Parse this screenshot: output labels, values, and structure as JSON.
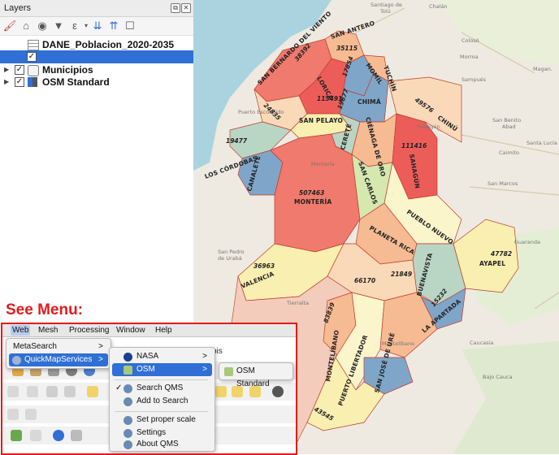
{
  "layers_panel": {
    "title": "Layers",
    "toolbar_icons": [
      "paintbrush-icon",
      "add-group-icon",
      "eye-icon",
      "filter-icon",
      "expression-filter-icon",
      "expand-all-icon",
      "collapse-all-icon",
      "remove-layer-icon"
    ],
    "layers": [
      {
        "name": "DANE_Poblacion_2020-2035",
        "checked": false,
        "icon": "table-icon"
      },
      {
        "name": "",
        "checked": true,
        "selected": true
      },
      {
        "name": "Municipios",
        "checked": true,
        "icon": "polygon-layer-icon",
        "expander": "▶"
      },
      {
        "name": "OSM Standard",
        "checked": true,
        "icon": "tile-layer-icon",
        "expander": "▶"
      }
    ]
  },
  "map": {
    "colors": {
      "dark_red": "#ec5d5a",
      "red": "#ef7a6d",
      "peach": "#f6bb92",
      "light_peach": "#fad9b8",
      "yellow": "#f8efb0",
      "light_yellow": "#fbf5cc",
      "green": "#d5e8b0",
      "blue": "#7fa6c9",
      "pale": "#f4e4c8",
      "teal": "#b9d6c5",
      "border": "#c0392b"
    },
    "base_labels": [
      "Santiago de\nTolú",
      "Chalán",
      "Colosó",
      "Morroa",
      "Sampués",
      "Magan.",
      "San Benito\nAbad",
      "Caimito",
      "San Marcos",
      "Santa Lucía",
      "Guaranda",
      "San Pedro\nde Urabá",
      "Caucasia",
      "Bajo Cauca",
      "Tierralta",
      "Montelíbano",
      "Puerto Escondido",
      "Tuchín",
      "Sahagún",
      "Cereté",
      "Montería",
      "Lorica",
      "Chimá",
      "Momil",
      "Purísima"
    ],
    "municipios": [
      {
        "name": "SAN ANTERO",
        "value": "35115"
      },
      {
        "name": "SAN BERNARDO DEL VIENTO",
        "value": "38392"
      },
      {
        "name": "MOMIL",
        "value": "17854"
      },
      {
        "name": "TUCHÍN",
        "value": ""
      },
      {
        "name": "LORICA",
        "value": "115491"
      },
      {
        "name": "CHIMÁ",
        "value": "19677"
      },
      {
        "name": "CHINÚ",
        "value": "49576"
      },
      {
        "name": "SAN PELAYO",
        "value": ""
      },
      {
        "name": "MOÑITOS",
        "value": "24835"
      },
      {
        "name": "LOS CÓRDOBAS",
        "value": "19477"
      },
      {
        "name": "CERETÉ",
        "value": ""
      },
      {
        "name": "CIÉNAGA DE ORO",
        "value": ""
      },
      {
        "name": "SAHAGÚN",
        "value": "111416"
      },
      {
        "name": "CANALETE",
        "value": ""
      },
      {
        "name": "MONTERÍA",
        "value": "507463"
      },
      {
        "name": "SAN CARLOS",
        "value": ""
      },
      {
        "name": "PUEBLO NUEVO",
        "value": ""
      },
      {
        "name": "PLANETA RICA",
        "value": ""
      },
      {
        "name": "AYAPEL",
        "value": "47782"
      },
      {
        "name": "VALENCIA",
        "value": "36963"
      },
      {
        "name": "BUENAVISTA",
        "value": "21849"
      },
      {
        "name": "",
        "value": "66170"
      },
      {
        "name": "LA APARTADA",
        "value": "15232"
      },
      {
        "name": "MONTELÍBANO",
        "value": "83839"
      },
      {
        "name": "PUERTO LIBERTADOR",
        "value": ""
      },
      {
        "name": "SAN JOSÉ DE URÉ",
        "value": ""
      },
      {
        "name": "",
        "value": "43545"
      }
    ]
  },
  "overlay": {
    "heading": "See Menu:",
    "menubar": [
      "Web",
      "Mesh",
      "Processing",
      "Window",
      "Help"
    ],
    "web_menu": {
      "items": [
        "MetaSearch",
        "QuickMapServices"
      ],
      "arrow": ">"
    },
    "qms_menu": {
      "items": [
        "NASA",
        "OSM",
        "Search QMS",
        "Add to Search",
        "Set proper scale",
        "Settings",
        "About QMS"
      ],
      "checkmark": "✓"
    },
    "osm_menu": {
      "items": [
        "OSM Standard"
      ]
    },
    "ghost_text": "bis"
  }
}
